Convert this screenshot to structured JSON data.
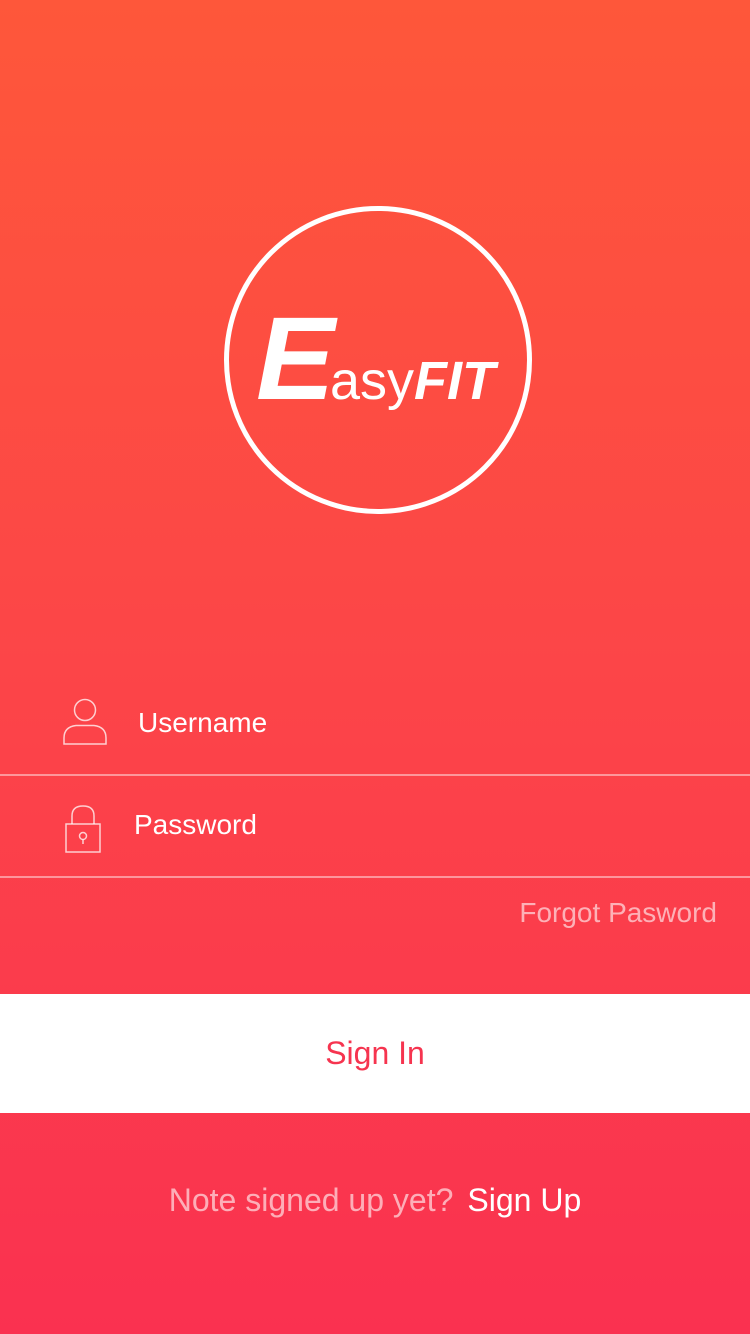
{
  "logo": {
    "letter_e": "E",
    "letters_asy": "asy",
    "letters_fit": "FIT"
  },
  "form": {
    "username": {
      "placeholder": "Username",
      "value": "",
      "icon": "user-icon"
    },
    "password": {
      "placeholder": "Password",
      "value": "",
      "icon": "lock-icon"
    },
    "forgot_label": "Forgot Pasword"
  },
  "signin": {
    "label": "Sign In"
  },
  "footer": {
    "prompt": "Note signed up yet?",
    "signup_label": "Sign Up"
  },
  "colors": {
    "gradient_top": "#FE573A",
    "gradient_bottom": "#FA3150",
    "accent": "#F6344F",
    "button_bg": "#FFFFFF"
  }
}
